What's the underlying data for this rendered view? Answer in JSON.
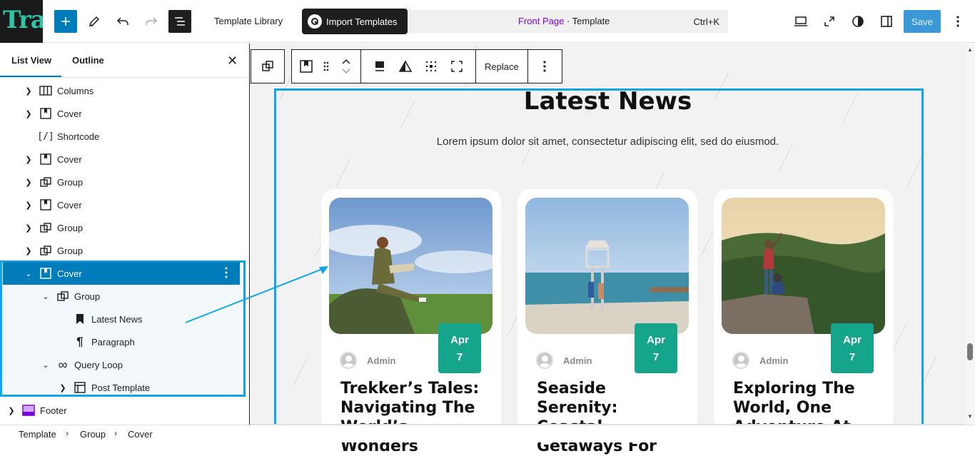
{
  "app": {
    "logo_text": "Tra"
  },
  "toolbar": {
    "template_library": "Template Library",
    "import_templates": "Import Templates",
    "cmd_front": "Front Page",
    "cmd_sep": " · ",
    "cmd_template": "Template",
    "cmd_shortcut": "Ctrl+K",
    "save_label": "Save"
  },
  "sidebar": {
    "tabs": [
      "List View",
      "Outline"
    ],
    "items": [
      {
        "label": "Columns",
        "icon": "columns-icon"
      },
      {
        "label": "Cover",
        "icon": "cover-icon"
      },
      {
        "label": "Shortcode",
        "icon": "shortcode-icon"
      },
      {
        "label": "Cover",
        "icon": "cover-icon"
      },
      {
        "label": "Group",
        "icon": "group-icon"
      },
      {
        "label": "Cover",
        "icon": "cover-icon"
      },
      {
        "label": "Group",
        "icon": "group-icon"
      },
      {
        "label": "Group",
        "icon": "group-icon"
      },
      {
        "label": "Cover",
        "icon": "cover-icon"
      },
      {
        "label": "Group",
        "icon": "group-icon"
      },
      {
        "label": "Latest News",
        "icon": "heading-icon"
      },
      {
        "label": "Paragraph",
        "icon": "paragraph-icon"
      },
      {
        "label": "Query Loop",
        "icon": "loop-icon"
      },
      {
        "label": "Post Template",
        "icon": "layout-icon"
      },
      {
        "label": "Footer",
        "icon": "footer-icon"
      }
    ]
  },
  "block_toolbar": {
    "replace_label": "Replace"
  },
  "content": {
    "heading": "Latest News",
    "subtitle": "Lorem ipsum dolor sit amet, consectetur adipiscing elit, sed do eiusmod.",
    "cards": [
      {
        "author": "Admin",
        "month": "Apr",
        "day": "7",
        "title": "Trekker’s Tales: Navigating The World’s Wonders"
      },
      {
        "author": "Admin",
        "month": "Apr",
        "day": "7",
        "title": "Seaside Serenity: Coastal Getaways For"
      },
      {
        "author": "Admin",
        "month": "Apr",
        "day": "7",
        "title": "Exploring The World, One Adventure At"
      }
    ]
  },
  "breadcrumb": [
    "Template",
    "Group",
    "Cover"
  ],
  "colors": {
    "accent": "#007cba",
    "highlight": "#0ea5e9",
    "badge": "#14a58c",
    "import_btn": "#1e1e1e",
    "front_page": "#7a00df"
  }
}
